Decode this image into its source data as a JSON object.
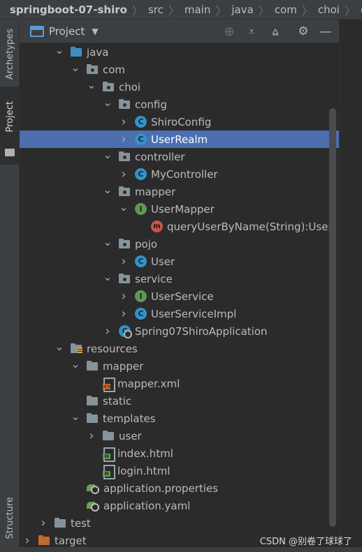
{
  "breadcrumb": {
    "items": [
      "springboot-07-shiro",
      "src",
      "main",
      "java",
      "com",
      "choi",
      "config"
    ],
    "trailing_icon": "C"
  },
  "side_tabs": {
    "archetypes": "Archetypes",
    "project": "Project",
    "structure": "Structure"
  },
  "panel": {
    "title": "Project",
    "dropdown_icon": "▼",
    "buttons": {
      "locate": "⊕",
      "expand_all": "⩡",
      "collapse_all": "⩠",
      "settings": "⚙",
      "hide": "—"
    }
  },
  "tree": [
    {
      "label": "java",
      "icon": "folder-blue",
      "arrow": "open",
      "level": 3
    },
    {
      "label": "com",
      "icon": "package",
      "arrow": "open",
      "level": 4
    },
    {
      "label": "choi",
      "icon": "package",
      "arrow": "open",
      "level": 5
    },
    {
      "label": "config",
      "icon": "package",
      "arrow": "open",
      "level": 6
    },
    {
      "label": "ShiroConfig",
      "icon": "class",
      "glyph": "C",
      "arrow": "closed",
      "level": 7
    },
    {
      "label": "UserRealm",
      "icon": "class",
      "glyph": "C",
      "arrow": "closed",
      "level": 7,
      "selected": true
    },
    {
      "label": "controller",
      "icon": "package",
      "arrow": "open",
      "level": 6
    },
    {
      "label": "MyController",
      "icon": "class",
      "glyph": "C",
      "arrow": "closed",
      "level": 7
    },
    {
      "label": "mapper",
      "icon": "package",
      "arrow": "open",
      "level": 6
    },
    {
      "label": "UserMapper",
      "icon": "interface",
      "glyph": "I",
      "arrow": "open",
      "level": 7
    },
    {
      "label": "queryUserByName(String):User",
      "icon": "method",
      "glyph": "m",
      "arrow": "none",
      "level": 8
    },
    {
      "label": "pojo",
      "icon": "package",
      "arrow": "open",
      "level": 6
    },
    {
      "label": "User",
      "icon": "class",
      "glyph": "C",
      "arrow": "closed",
      "level": 7
    },
    {
      "label": "service",
      "icon": "package",
      "arrow": "open",
      "level": 6
    },
    {
      "label": "UserService",
      "icon": "interface",
      "glyph": "I",
      "arrow": "closed",
      "level": 7
    },
    {
      "label": "UserServiceImpl",
      "icon": "class",
      "glyph": "C",
      "arrow": "closed",
      "level": 7
    },
    {
      "label": "Spring07ShiroApplication",
      "icon": "app",
      "glyph": "C",
      "arrow": "closed",
      "level": 6
    },
    {
      "label": "resources",
      "icon": "folder-res",
      "arrow": "open",
      "level": 3
    },
    {
      "label": "mapper",
      "icon": "folder",
      "arrow": "open",
      "level": 4
    },
    {
      "label": "mapper.xml",
      "icon": "file-xml",
      "arrow": "none",
      "level": 5
    },
    {
      "label": "static",
      "icon": "folder",
      "arrow": "none",
      "level": 4
    },
    {
      "label": "templates",
      "icon": "folder",
      "arrow": "open",
      "level": 4
    },
    {
      "label": "user",
      "icon": "folder",
      "arrow": "closed",
      "level": 5
    },
    {
      "label": "index.html",
      "icon": "file-html",
      "arrow": "none",
      "level": 5
    },
    {
      "label": "login.html",
      "icon": "file-html",
      "arrow": "none",
      "level": 5
    },
    {
      "label": "application.properties",
      "icon": "spring",
      "arrow": "none",
      "level": 4
    },
    {
      "label": "application.yaml",
      "icon": "spring",
      "arrow": "none",
      "level": 4
    },
    {
      "label": "test",
      "icon": "folder",
      "arrow": "closed",
      "level": 2
    },
    {
      "label": "target",
      "icon": "folder-orange",
      "arrow": "closed",
      "level": 1
    }
  ],
  "colors": {
    "selection": "#4b6eaf",
    "class_icon": "#3592c4",
    "interface_icon": "#629755",
    "method_icon": "#c75450",
    "target_folder": "#c2692c"
  },
  "watermark": "CSDN @别卷了球球了"
}
